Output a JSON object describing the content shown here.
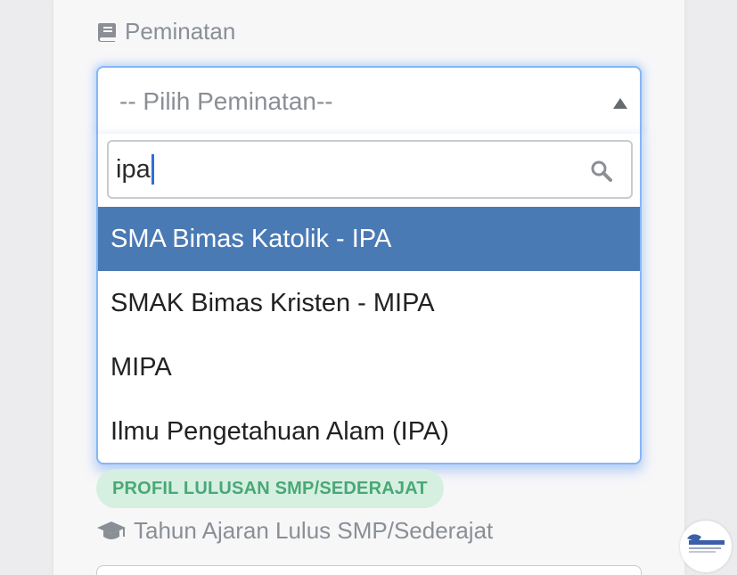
{
  "peminatan": {
    "label": "Peminatan",
    "icon": "book-icon",
    "placeholder": "-- Pilih Peminatan--",
    "search_value": "ipa",
    "options": [
      "SMA Bimas Katolik - IPA",
      "SMAK Bimas Kristen - MIPA",
      "MIPA",
      "Ilmu Pengetahuan Alam (IPA)"
    ],
    "highlighted_index": 0
  },
  "section_badge": "PROFIL LULUSAN SMP/SEDERAJAT",
  "tahun_ajaran": {
    "label": "Tahun Ajaran Lulus SMP/Sederajat",
    "icon": "graduation-cap-icon"
  },
  "colors": {
    "focus_border": "#86b7f6",
    "highlight": "#4a7ab4",
    "badge_bg": "#d5efe0",
    "badge_text": "#49a877"
  }
}
